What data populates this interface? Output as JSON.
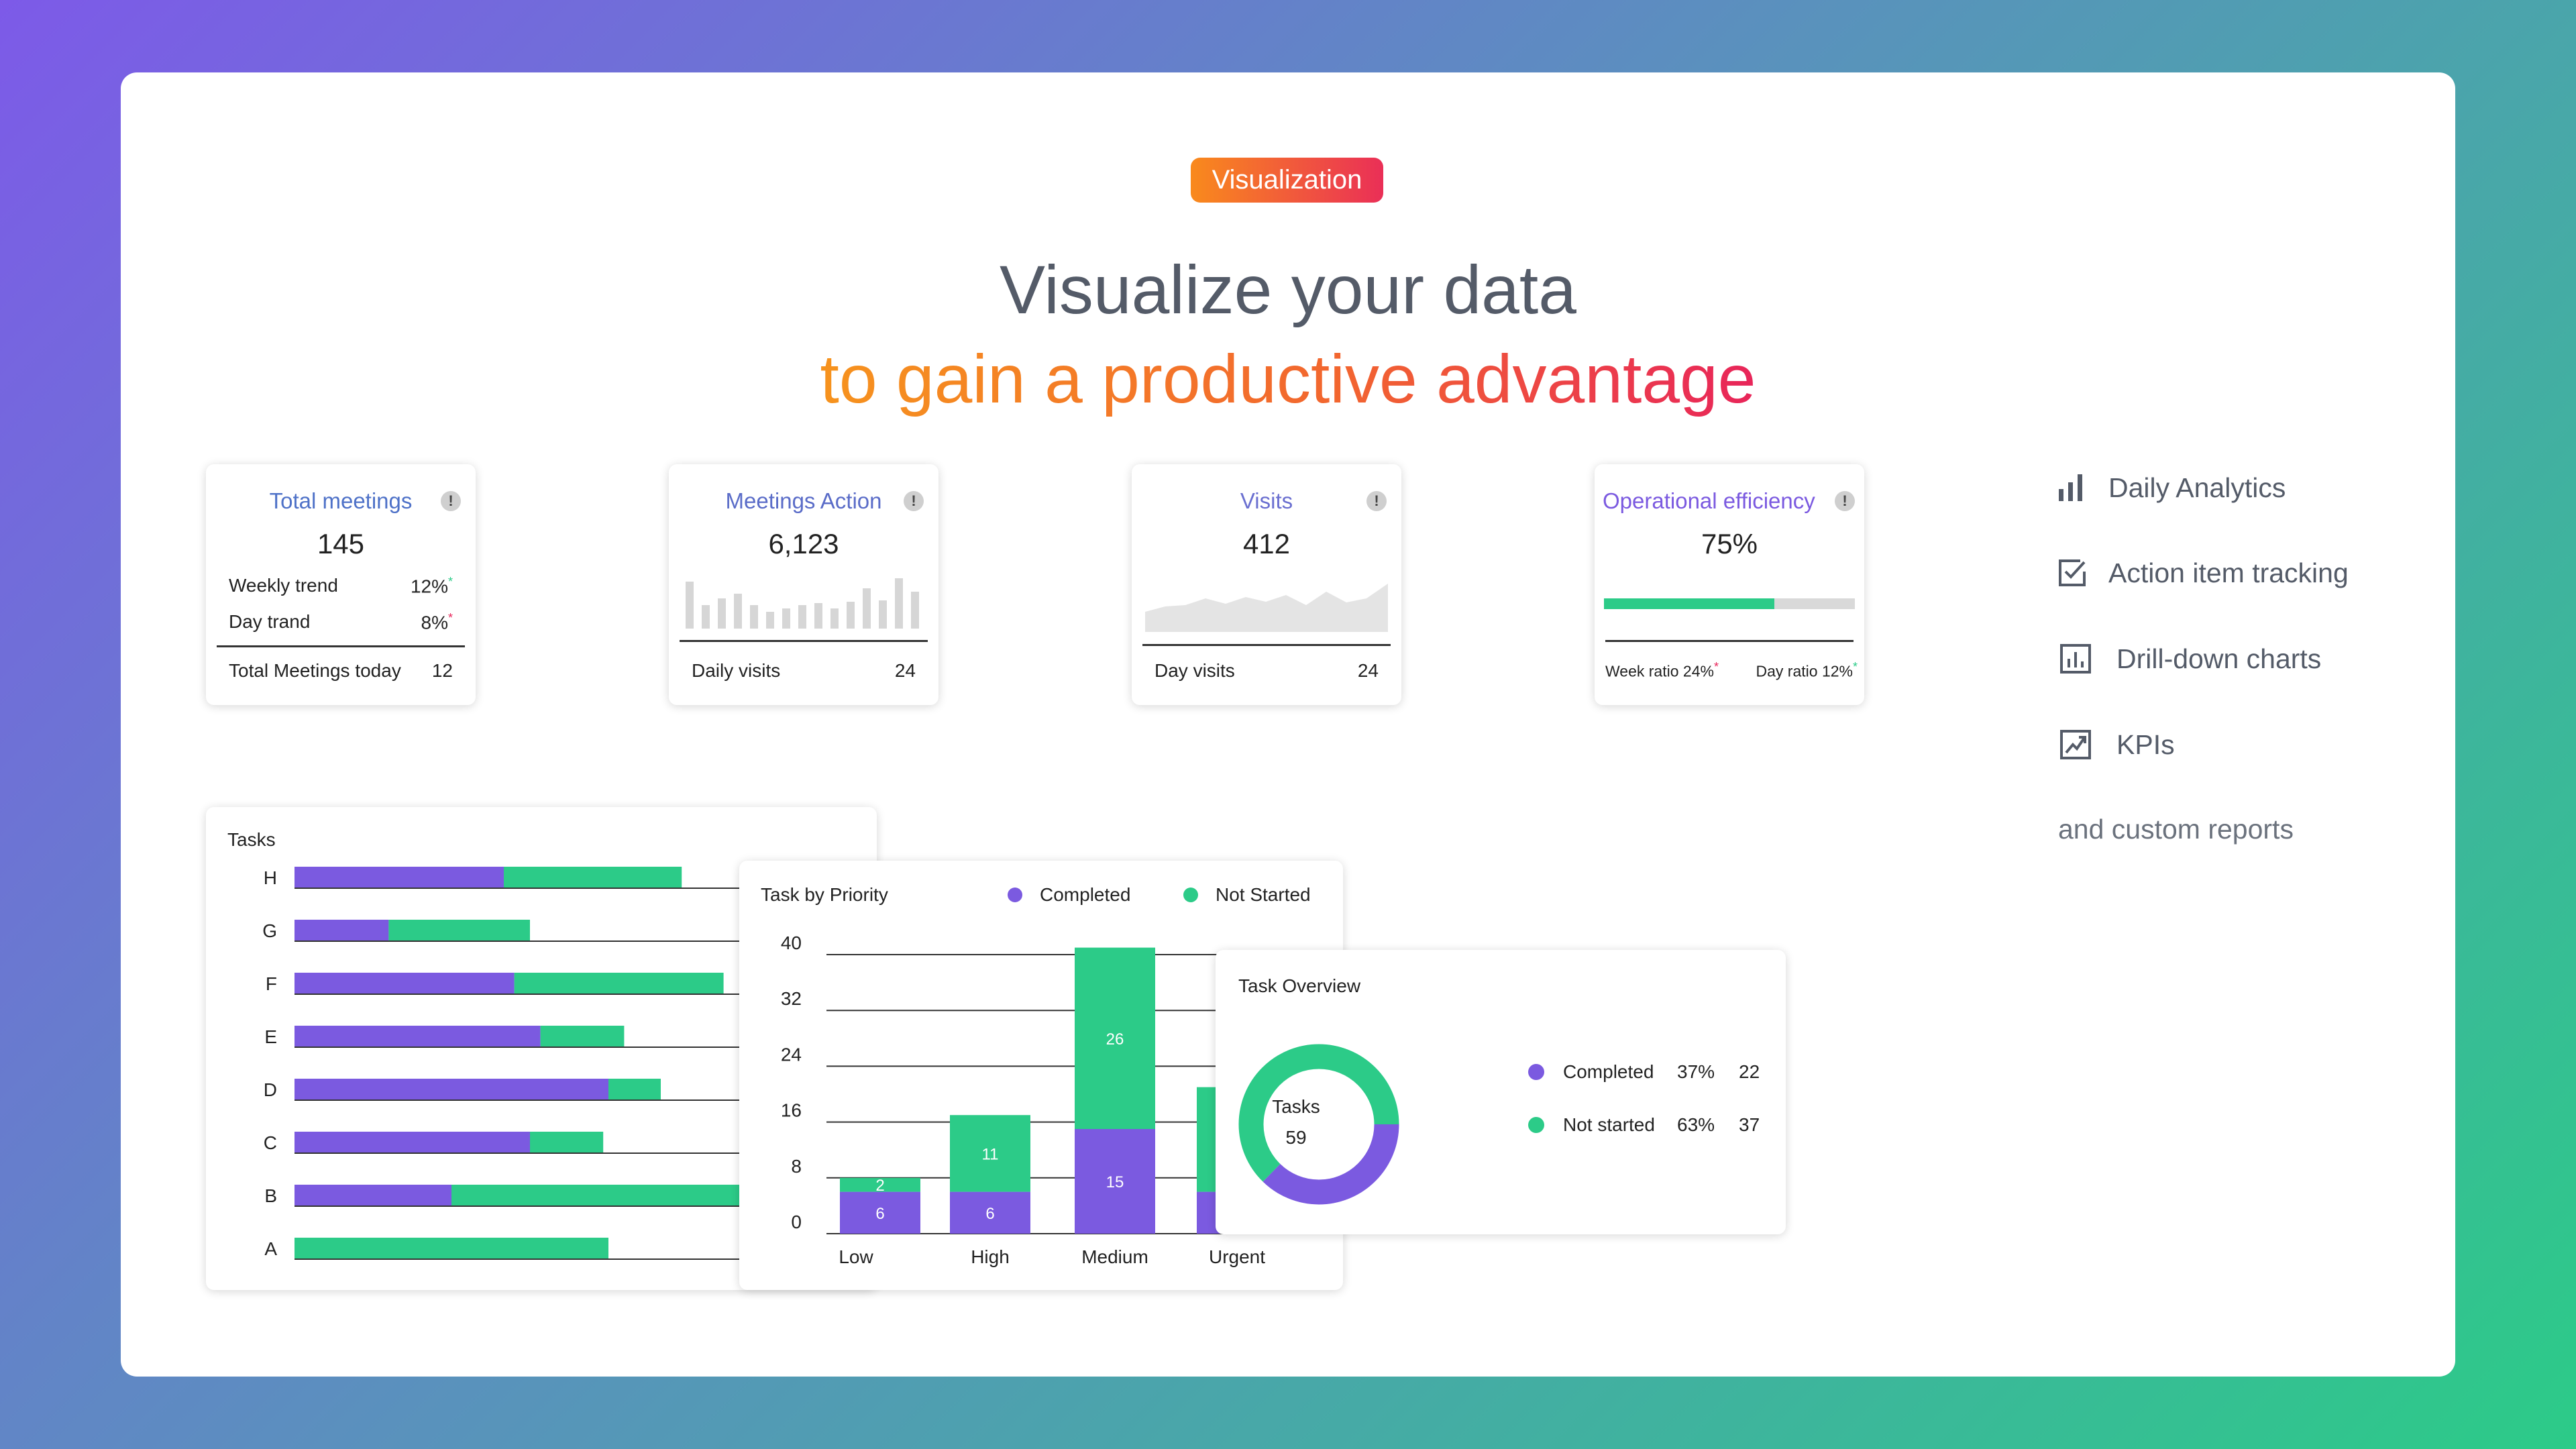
{
  "badge": "Visualization",
  "headline": {
    "line1": "Visualize your data",
    "line2": "to gain a productive advantage"
  },
  "kpis": {
    "total_meetings": {
      "title": "Total meetings",
      "value": "145",
      "weekly_label": "Weekly trend",
      "weekly_value": "12%",
      "day_label": "Day trand",
      "day_value": "8%",
      "footer_label": "Total Meetings today",
      "footer_value": "12"
    },
    "meetings_action": {
      "title": "Meetings Action",
      "value": "6,123",
      "footer_label": "Daily visits",
      "footer_value": "24"
    },
    "visits": {
      "title": "Visits",
      "value": "412",
      "footer_label": "Day visits",
      "footer_value": "24"
    },
    "operational_efficiency": {
      "title": "Operational efficiency",
      "value": "75%",
      "progress": 0.68,
      "week_ratio": "Week ratio 24%",
      "day_ratio": "Day ratio 12%"
    }
  },
  "features": [
    {
      "icon": "bar-chart-icon",
      "label": "Daily Analytics"
    },
    {
      "icon": "checkbox-icon",
      "label": "Action item tracking"
    },
    {
      "icon": "chart-box-icon",
      "label": "Drill-down charts"
    },
    {
      "icon": "trend-icon",
      "label": "KPIs"
    }
  ],
  "custom_reports": "and custom reports",
  "colors": {
    "completed": "#7b5ae0",
    "not_started": "#2ccb88",
    "accent_orange": "#f98a1c",
    "accent_red": "#e8255a"
  },
  "chart_data": [
    {
      "type": "bar",
      "orientation": "horizontal",
      "stacked": true,
      "title": "Tasks",
      "categories": [
        "H",
        "G",
        "F",
        "E",
        "D",
        "C",
        "B",
        "A"
      ],
      "series": [
        {
          "values": [
            40,
            18,
            42,
            47,
            60,
            45,
            30,
            0
          ]
        },
        {
          "values": [
            34,
            27,
            40,
            16,
            10,
            14,
            60,
            60
          ]
        }
      ],
      "xlim": [
        0,
        100
      ]
    },
    {
      "type": "bar",
      "stacked": true,
      "title": "Task by Priority",
      "categories": [
        "Low",
        "High",
        "Medium",
        "Urgent"
      ],
      "series": [
        {
          "name": "Completed",
          "values": [
            6,
            6,
            15,
            6
          ]
        },
        {
          "name": "Not Started",
          "values": [
            2,
            11,
            26,
            15
          ]
        }
      ],
      "yticks": [
        "40",
        "32",
        "24",
        "16",
        "8",
        "0"
      ],
      "ylim": [
        0,
        40
      ],
      "legend": "top-right"
    },
    {
      "type": "pie",
      "title": "Task Overview",
      "center_label": "Tasks",
      "center_value": "59",
      "slices": [
        {
          "name": "Completed",
          "percent": "37%",
          "value": "22"
        },
        {
          "name": "Not started",
          "percent": "63%",
          "value": "37"
        }
      ]
    }
  ]
}
